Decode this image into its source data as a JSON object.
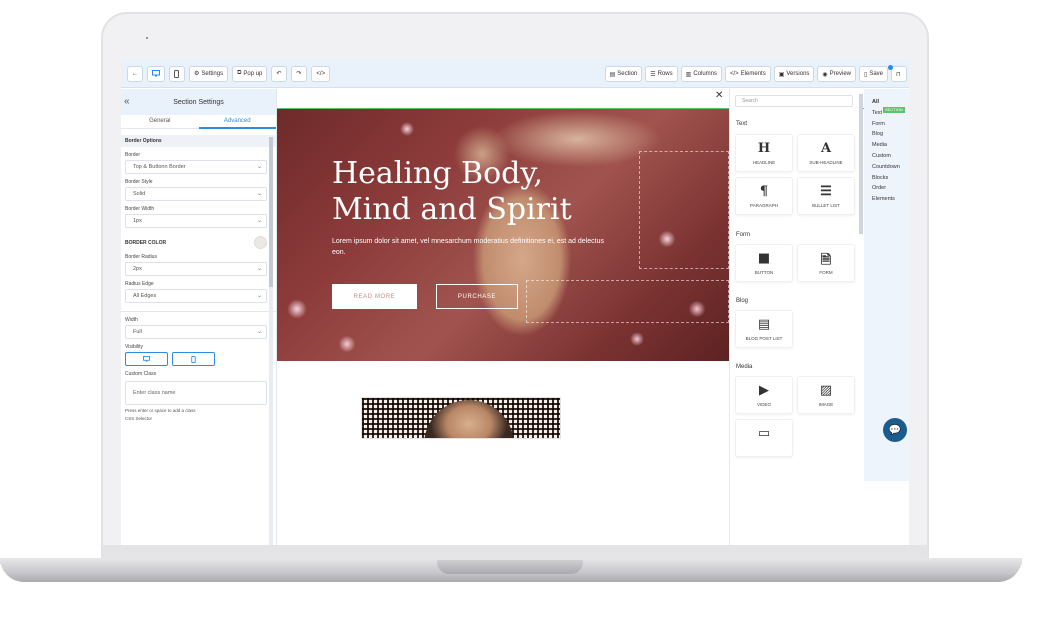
{
  "toolbar": {
    "back": "←",
    "settings": "Settings",
    "popup": "Pop up",
    "section": "Section",
    "rows": "Rows",
    "columns": "Columns",
    "elements": "Elements",
    "versions": "Versions",
    "preview": "Preview",
    "save": "Save"
  },
  "left_panel": {
    "title": "Section Settings",
    "collapse_glyph": "«",
    "tabs": [
      "General",
      "Advanced"
    ],
    "active_tab": "Advanced",
    "border_options": "Border Options",
    "border_label": "Border",
    "border_value": "Top & Buttonn Border",
    "border_style_label": "Border Style",
    "border_style_value": "Solid",
    "border_width_label": "Border Width",
    "border_width_value": "1px",
    "border_color_label": "BORDER COLOR",
    "border_radius_label": "Border Radius",
    "border_radius_value": "2px",
    "radius_edge_label": "Radius Edge",
    "radius_edge_value": "All Edges",
    "width_label": "Width",
    "width_value": "Full",
    "visibility_label": "Visibility",
    "custom_class_label": "Custom Class",
    "custom_class_placeholder": "Enter class name",
    "hint": "Press enter or space to add a class",
    "css_selector_label": "CSS Selector"
  },
  "hero": {
    "title_line1": "Healing Body,",
    "title_line2": "Mind and Spirit",
    "text": "Lorem ipsum dolor sit amet, vel mnesarchum moderatius definitiones ei, est ad delectus eon.",
    "read_more": "READ MORE",
    "purchase": "PURCHASE"
  },
  "elements_panel": {
    "search_placeholder": "Search",
    "categories": {
      "text": "Text",
      "form": "Form",
      "blog": "Blog",
      "media": "Media"
    },
    "tiles": {
      "headline": "HEADLINE",
      "sub_headline": "SUB-HEADLINE",
      "paragraph": "PARAGRAPH",
      "bullet_list": "BULLET LIST",
      "button": "BUTTON",
      "form": "FORM",
      "blog_post_list": "BLOG POST LIST",
      "video": "VIDEO",
      "image": "IMAGE"
    }
  },
  "category_list": [
    "All",
    "Text",
    "Form",
    "Blog",
    "Media",
    "Custom",
    "Countdown",
    "Blocks",
    "Order Elements"
  ],
  "section_badge": "SECTION",
  "colors": {
    "accent": "#2b8be6",
    "section_line": "#5ac46a",
    "chat": "#1b5c8e"
  }
}
